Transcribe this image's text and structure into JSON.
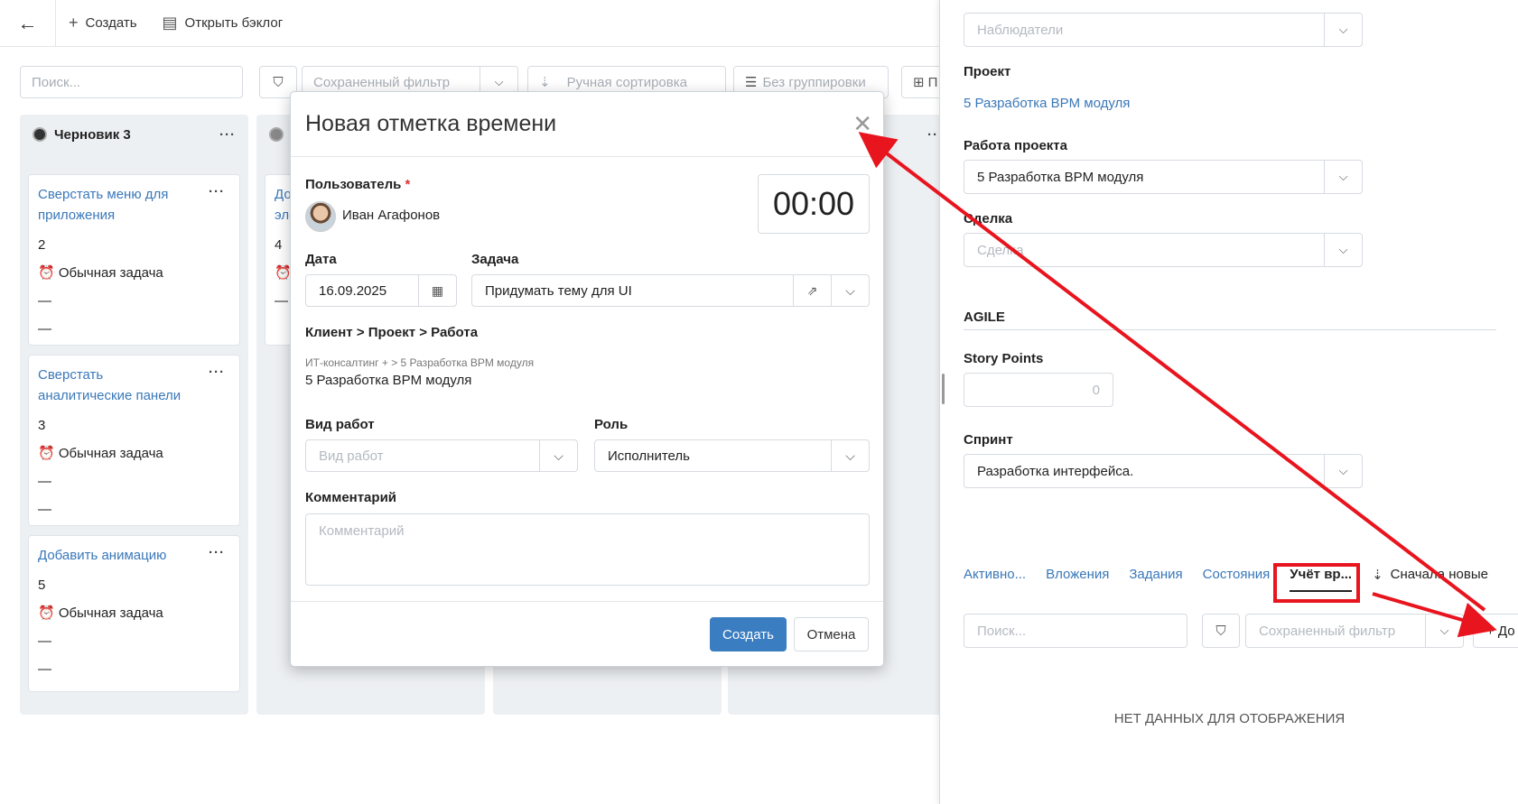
{
  "toolbar": {
    "back_icon": "arrow-left-icon",
    "create_label": "Создать",
    "open_backlog_label": "Открыть бэклог"
  },
  "filters": {
    "search_placeholder": "Поиск...",
    "saved_filter_placeholder": "Сохраненный фильтр",
    "sort_label": "Ручная сортировка",
    "group_label": "Без группировки",
    "view_label_fragment": "П"
  },
  "board": {
    "column1": {
      "title": "Черновик 3",
      "cards": [
        {
          "title": "Сверстать меню для приложения",
          "points": "2",
          "type": "Обычная задача",
          "line1": "—",
          "line2": "—"
        },
        {
          "title": "Сверстать аналитические панели",
          "points": "3",
          "type": "Обычная задача",
          "line1": "—",
          "line2": "—"
        },
        {
          "title": "Добавить анимацию",
          "points": "5",
          "type": "Обычная задача",
          "line1": "—",
          "line2": "—"
        }
      ]
    },
    "column2": {
      "card_title_fragment": "До эле",
      "points": "4",
      "line2": "—"
    }
  },
  "modal": {
    "title": "Новая отметка времени",
    "timer": "00:00",
    "user_label": "Пользователь",
    "required_mark": "*",
    "user_name": "Иван Агафонов",
    "date_label": "Дата",
    "date_value": "16.09.2025",
    "task_label": "Задача",
    "task_value": "Придумать тему для UI",
    "client_path_label": "Клиент > Проект > Работа",
    "client_path_small": "ИТ-консалтинг + > 5 Разработка BPM модуля",
    "client_path_value": "5 Разработка BPM модуля",
    "worktype_label": "Вид работ",
    "worktype_placeholder": "Вид работ",
    "role_label": "Роль",
    "role_value": "Исполнитель",
    "comment_label": "Комментарий",
    "comment_placeholder": "Комментарий",
    "create_button": "Создать",
    "cancel_button": "Отмена"
  },
  "panel": {
    "watchers_placeholder": "Наблюдатели",
    "project_label": "Проект",
    "project_link": "5 Разработка BPM модуля",
    "project_work_label": "Работа проекта",
    "project_work_value": "5 Разработка BPM модуля",
    "deal_label": "Сделка",
    "deal_placeholder": "Сделка",
    "agile_heading": "AGILE",
    "story_points_label": "Story Points",
    "story_points_value": "0",
    "sprint_label": "Спринт",
    "sprint_value": "Разработка интерфейса.",
    "tabs": [
      "Активно...",
      "Вложения",
      "Задания",
      "Состояния",
      "Учёт вр..."
    ],
    "sort_label": "Сначала новые",
    "search_placeholder": "Поиск...",
    "saved_filter_placeholder": "Сохраненный фильтр",
    "add_button_fragment": "+ До",
    "empty_text": "НЕТ ДАННЫХ ДЛЯ ОТОБРАЖЕНИЯ"
  },
  "colors": {
    "accent": "#3a7dc0",
    "link": "#3a78b9",
    "annotation": "#e8141e"
  }
}
